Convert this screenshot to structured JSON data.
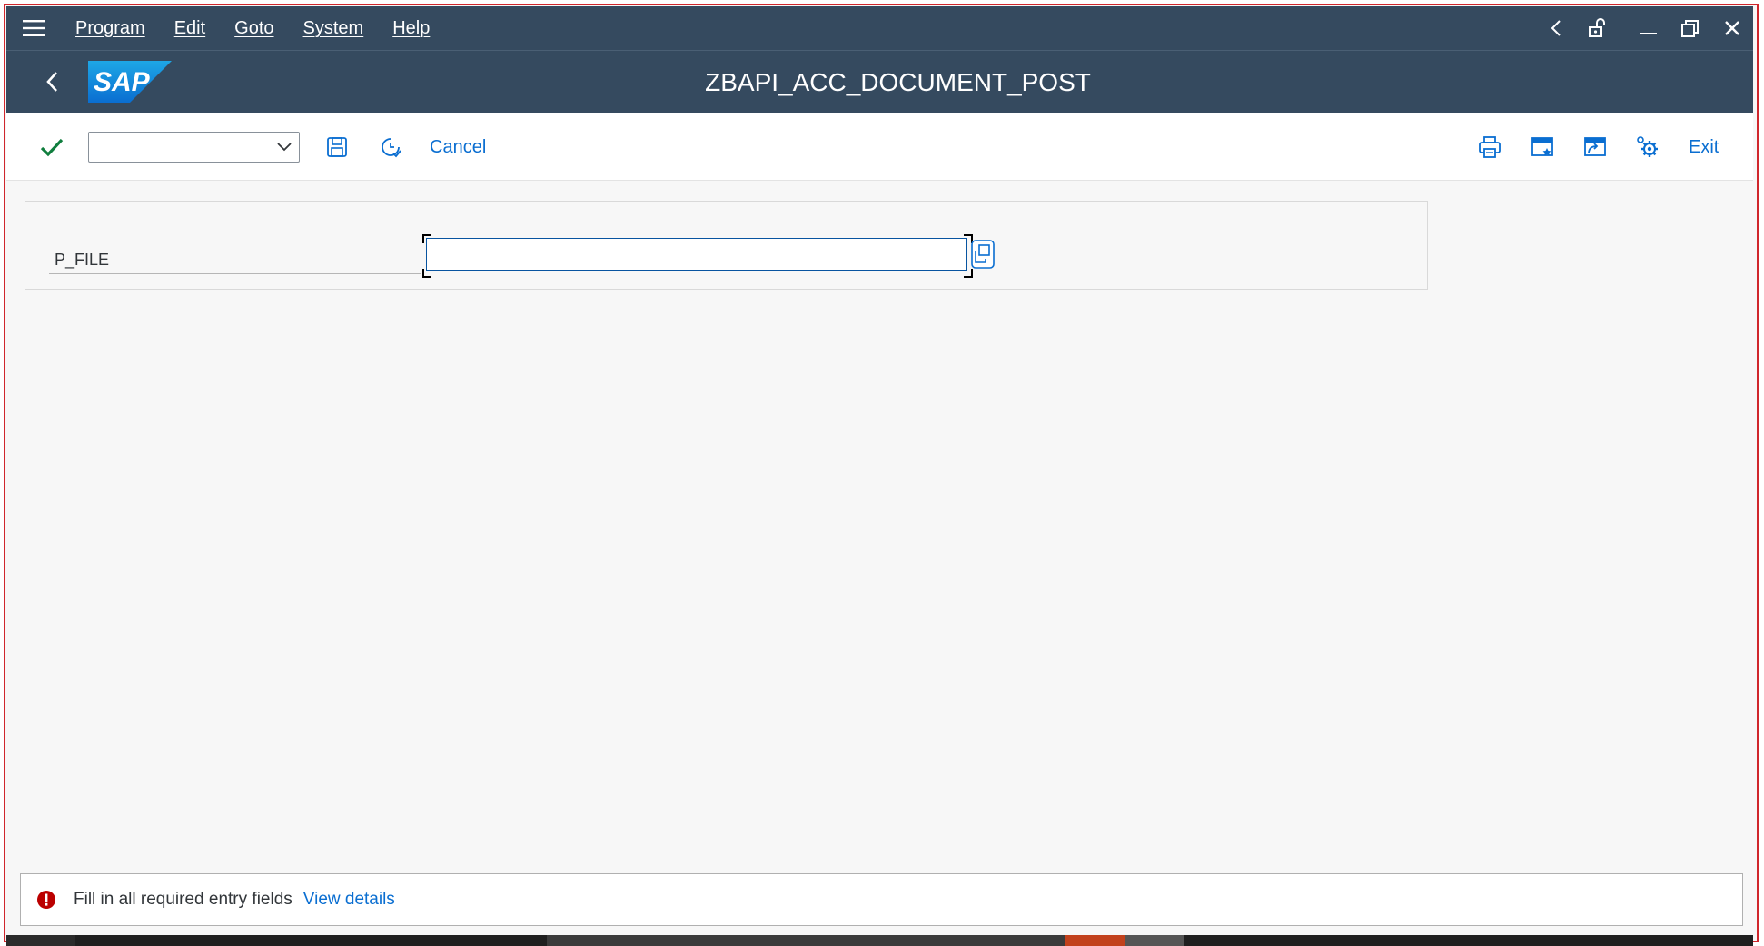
{
  "menu": {
    "items": [
      {
        "label": "Program"
      },
      {
        "label": "Edit"
      },
      {
        "label": "Goto"
      },
      {
        "label": "System"
      },
      {
        "label": "Help"
      }
    ]
  },
  "window_controls": [
    "chevron-left-icon",
    "lock-icon",
    "minimize-icon",
    "restore-icon",
    "close-icon"
  ],
  "header": {
    "logo_text": "SAP",
    "title": "ZBAPI_ACC_DOCUMENT_POST"
  },
  "toolbar": {
    "command_field_value": "",
    "cancel_label": "Cancel",
    "exit_label": "Exit",
    "icons": [
      "enter-check-icon",
      "save-icon",
      "history-icon",
      "print-icon",
      "new-session-icon",
      "create-shortcut-icon",
      "settings-icon"
    ]
  },
  "form": {
    "pfile_label": "P_FILE",
    "pfile_value": ""
  },
  "status": {
    "type": "error",
    "message": "Fill in all required entry fields",
    "link_label": "View details"
  },
  "colors": {
    "shell": "#354a5f",
    "accent": "#0a6ed1",
    "error": "#bb0000",
    "success": "#107e3e",
    "frame_border": "#d0262c"
  }
}
